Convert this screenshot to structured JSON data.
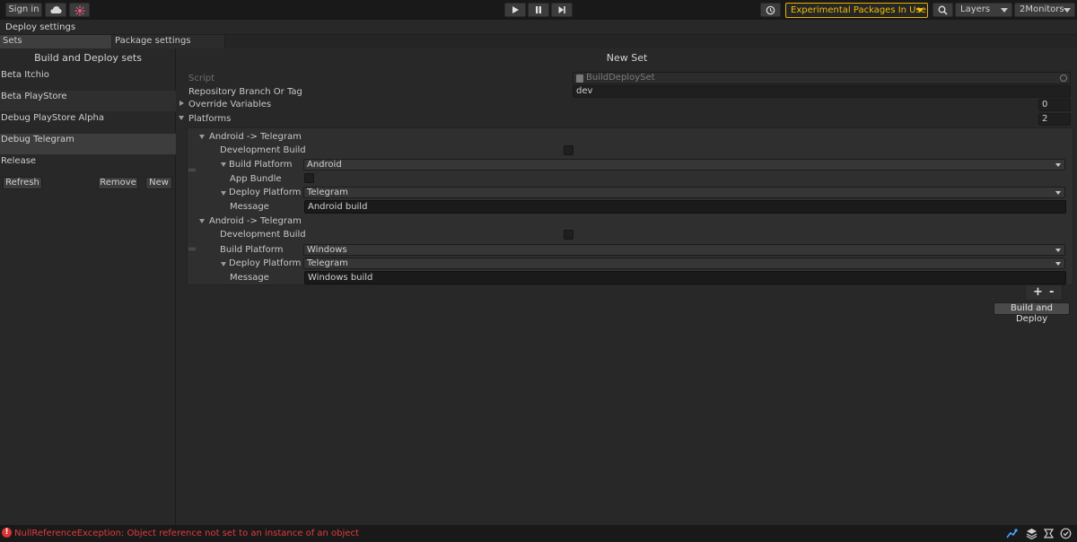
{
  "toolbar": {
    "sign_in": "Sign in",
    "experimental": "Experimental Packages In Use",
    "layers": "Layers",
    "layout": "2Monitors"
  },
  "window": {
    "title": "Deploy settings"
  },
  "tabs": {
    "sets": "Sets",
    "package_settings": "Package settings"
  },
  "left": {
    "title": "Build and Deploy sets",
    "items": [
      "Beta Itchio",
      "Beta PlayStore",
      "Debug PlayStore Alpha",
      "Debug Telegram",
      "Release"
    ],
    "selected_index": 3,
    "refresh": "Refresh",
    "remove": "Remove",
    "new": "New"
  },
  "main": {
    "title": "New Set",
    "script_label": "Script",
    "script_value": "BuildDeploySet",
    "repo_label": "Repository Branch Or Tag",
    "repo_value": "dev",
    "override_label": "Override Variables",
    "override_count": "0",
    "platforms_label": "Platforms",
    "platforms_count": "2",
    "platforms": [
      {
        "header": "Android -> Telegram",
        "dev_build_label": "Development Build",
        "build_platform_label": "Build Platform",
        "build_platform_value": "Android",
        "app_bundle_label": "App Bundle",
        "deploy_platform_label": "Deploy Platform",
        "deploy_platform_value": "Telegram",
        "message_label": "Message",
        "message_value": "Android build"
      },
      {
        "header": "Android -> Telegram",
        "dev_build_label": "Development Build",
        "build_platform_label": "Build Platform",
        "build_platform_value": "Windows",
        "deploy_platform_label": "Deploy Platform",
        "deploy_platform_value": "Telegram",
        "message_label": "Message",
        "message_value": "Windows build"
      }
    ],
    "plus": "+",
    "minus": "-",
    "build_deploy": "Build and Deploy"
  },
  "status": {
    "error_message": "NullReferenceException: Object reference not set to an instance of an object"
  },
  "colors": {
    "accent_warning": "#f0c000",
    "error": "#e03232",
    "background": "#282828"
  }
}
